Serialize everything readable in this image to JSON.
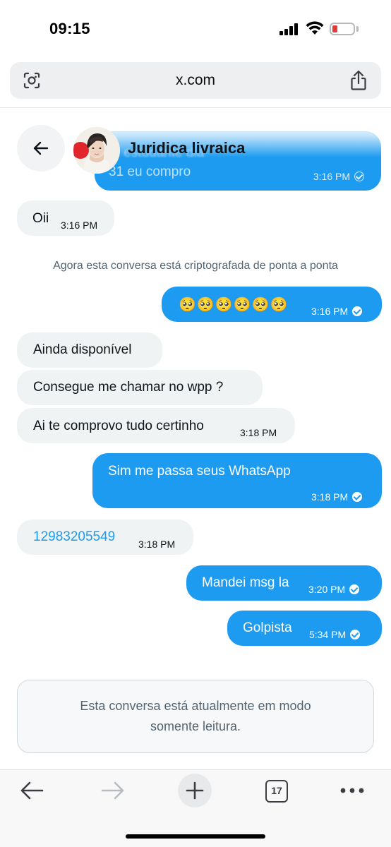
{
  "status_bar": {
    "time": "09:15"
  },
  "browser": {
    "url": "x.com",
    "tab_count": "17"
  },
  "header": {
    "contact_name": "Juridica livraica"
  },
  "top_message": {
    "line1": "... estudante dia",
    "line2": "31 eu compro",
    "time": "3:16 PM"
  },
  "messages": [
    {
      "side": "in",
      "text": "Oii",
      "time": "3:16 PM"
    },
    {
      "side": "out",
      "text": "🥺🥺🥺🥺🥺🥺",
      "time": "3:16 PM"
    },
    {
      "side": "in",
      "text": "Ainda disponível",
      "time": ""
    },
    {
      "side": "in",
      "text": "Consegue me chamar no wpp ?",
      "time": ""
    },
    {
      "side": "in",
      "text": "Ai te comprovo tudo certinho",
      "time": "3:18 PM"
    },
    {
      "side": "out",
      "text": "Sim me passa seus WhatsApp",
      "time": "3:18 PM"
    },
    {
      "side": "in",
      "text": "12983205549",
      "time": "3:18 PM"
    },
    {
      "side": "out",
      "text": "Mandei msg la",
      "time": "3:20 PM"
    },
    {
      "side": "out",
      "text": "Golpista",
      "time": "5:34 PM"
    }
  ],
  "system_note": "Agora esta conversa está criptografada de ponta a ponta",
  "read_only_notice": {
    "line1": "Esta conversa está atualmente em modo",
    "line2": "somente leitura."
  },
  "colors": {
    "accent": "#1d9bf0",
    "incoming_bubble": "#eff3f4",
    "muted_text": "#536471"
  },
  "icons": [
    "camera-search-icon",
    "share-icon",
    "back-arrow-icon",
    "forward-arrow-icon",
    "plus-icon",
    "tabs-icon",
    "more-icon"
  ]
}
